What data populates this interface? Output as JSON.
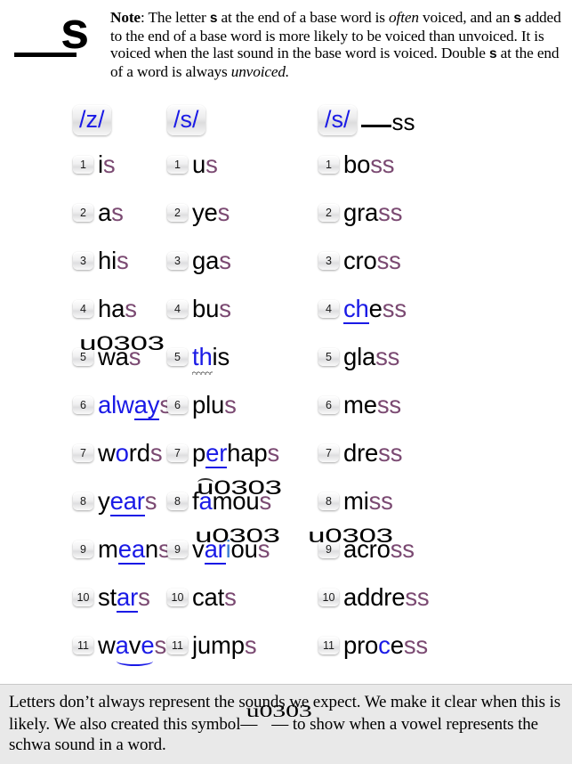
{
  "header": {
    "title_letter": "s",
    "note_label": "Note",
    "note_text": ": The letter s at the end of a base word is often voiced, and an s added to the end of a base word is more likely to be voiced than unvoiced. It is voiced when the last sound in the base word is voiced. Double s at the end of a word is always unvoiced."
  },
  "colors": {
    "blue": "#1a1ae6",
    "purple": "#7b4a72",
    "light_blue": "#3a7fd5",
    "footer_band": "#e9e9e9"
  },
  "columns": [
    {
      "header": "/z/",
      "suffix": "",
      "words": [
        "is",
        "as",
        "his",
        "has",
        "was",
        "always",
        "words",
        "years",
        "means",
        "stars",
        "waves"
      ],
      "numbers": [
        "1",
        "2",
        "3",
        "4",
        "5",
        "6",
        "7",
        "8",
        "9",
        "10",
        "11"
      ]
    },
    {
      "header": "/s/",
      "suffix": "",
      "words": [
        "us",
        "yes",
        "gas",
        "bus",
        "this",
        "plus",
        "perhaps",
        "famous",
        "various",
        "cats",
        "jumps"
      ],
      "numbers": [
        "1",
        "2",
        "3",
        "4",
        "5",
        "6",
        "7",
        "8",
        "9",
        "10",
        "11"
      ]
    },
    {
      "header": "/s/",
      "suffix": "ss",
      "words": [
        "boss",
        "grass",
        "cross",
        "chess",
        "glass",
        "mess",
        "dress",
        "miss",
        "across",
        "address",
        "process"
      ],
      "numbers": [
        "1",
        "2",
        "3",
        "4",
        "5",
        "6",
        "7",
        "8",
        "9",
        "10",
        "11"
      ]
    }
  ],
  "footer": {
    "line1": "Letters don’t always represent the sounds we expect. We make",
    "line2_a": "it clear when this is likely. We also created this symbol—",
    "line2_b": "— to",
    "line3": "show when a vowel represents the schwa sound in a word."
  }
}
